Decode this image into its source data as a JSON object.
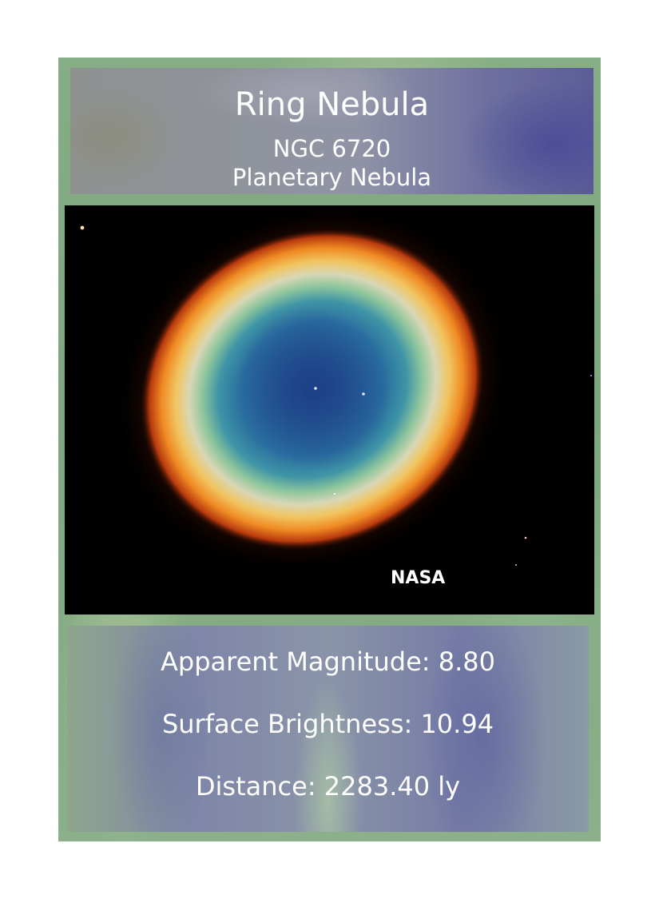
{
  "card": {
    "title": "Ring Nebula",
    "catalog_id": "NGC 6720",
    "object_type": "Planetary Nebula",
    "image": {
      "subject": "ring nebula photograph",
      "credit": "NASA"
    },
    "stats": [
      {
        "text": "Apparent Magnitude: 8.80"
      },
      {
        "text": "Surface Brightness: 10.94"
      },
      {
        "text": "Distance: 2283.40 ly"
      }
    ]
  }
}
